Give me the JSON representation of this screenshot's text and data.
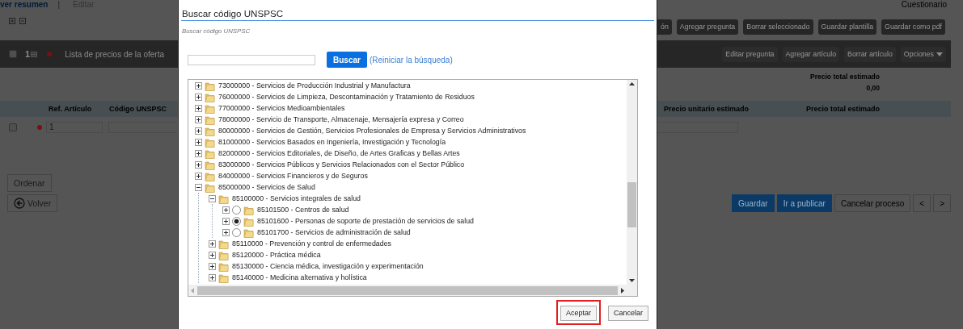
{
  "page_left": {
    "view_link": "ver resumen",
    "separator": "|",
    "edit_link": "Editar",
    "section_checked": false,
    "section_number": "1",
    "section_title": "Lista de precios de la oferta",
    "columns": [
      "Ref. Artículo",
      "Código UNSPSC"
    ],
    "row": {
      "checked": false,
      "ref": "1"
    },
    "sort_button": "Ordenar",
    "back_button": "Volver"
  },
  "page_right": {
    "title": "Cuestionario",
    "toolbar": [
      "ón",
      "Agregar pregunta",
      "Borrar seleccionado",
      "Guardar plantilla",
      "Guardar como pdf"
    ],
    "section_buttons": [
      "Editar pregunta",
      "Agregar artículo",
      "Borrar artículo",
      "Opciones"
    ],
    "total_label": "Precio total estimado",
    "total_value": "0,00",
    "columns": [
      "Precio unitario estimado",
      "Precio total estimado"
    ],
    "actions": [
      {
        "label": "Guardar",
        "kind": "primary"
      },
      {
        "label": "Ir a publicar",
        "kind": "primary"
      },
      {
        "label": "Cancelar proceso",
        "kind": "default"
      },
      {
        "label": "<",
        "kind": "default"
      },
      {
        "label": ">",
        "kind": "default"
      }
    ]
  },
  "dialog": {
    "title": "Buscar código UNSPSC",
    "subtitle": "Buscar código UNSPSC",
    "search_button": "Buscar",
    "reset_link": "(Reiniciar la búsqueda)",
    "tree": [
      {
        "kind": "group",
        "label": "73000000 - Servicios de Producción Industrial y Manufactura",
        "expanded": false
      },
      {
        "kind": "group",
        "label": "76000000 - Servicios de Limpieza, Descontaminación y Tratamiento de Residuos",
        "expanded": false
      },
      {
        "kind": "group",
        "label": "77000000 - Servicios Medioambientales",
        "expanded": false
      },
      {
        "kind": "group",
        "label": "78000000 - Servicio de Transporte, Almacenaje, Mensajería expresa y Correo",
        "expanded": false
      },
      {
        "kind": "group",
        "label": "80000000 - Servicios de Gestión, Servicios Profesionales de Empresa y Servicios Administrativos",
        "expanded": false
      },
      {
        "kind": "group",
        "label": "81000000 - Servicios Basados en Ingeniería, Investigación y Tecnología",
        "expanded": false
      },
      {
        "kind": "group",
        "label": "82000000 - Servicios Editoriales, de Diseño, de Artes Graficas y Bellas Artes",
        "expanded": false
      },
      {
        "kind": "group",
        "label": "83000000 - Servicios Públicos y Servicios Relacionados con el Sector Público",
        "expanded": false
      },
      {
        "kind": "group",
        "label": "84000000 - Servicios Financieros y de Seguros",
        "expanded": false
      },
      {
        "kind": "group",
        "label": "85000000 - Servicios de Salud",
        "expanded": true,
        "children": [
          {
            "kind": "group",
            "label": "85100000 - Servicios integrales de salud",
            "expanded": true,
            "children": [
              {
                "kind": "option",
                "label": "85101500 - Centros de salud",
                "expanded": false,
                "selected": false
              },
              {
                "kind": "option",
                "label": "85101600 - Personas de soporte de prestación de servicios de salud",
                "expanded": false,
                "selected": true
              },
              {
                "kind": "option",
                "label": "85101700 - Servicios de administración de salud",
                "expanded": false,
                "selected": false
              }
            ]
          },
          {
            "kind": "group",
            "label": "85110000 - Prevención y control de enfermedades",
            "expanded": false
          },
          {
            "kind": "group",
            "label": "85120000 - Práctica médica",
            "expanded": false
          },
          {
            "kind": "group",
            "label": "85130000 - Ciencia médica, investigación y experimentación",
            "expanded": false
          },
          {
            "kind": "group",
            "label": "85140000 - Medicina alternativa y holística",
            "expanded": false
          }
        ]
      }
    ],
    "buttons": [
      {
        "label": "Aceptar",
        "highlighted": true
      },
      {
        "label": "Cancelar",
        "highlighted": false
      }
    ]
  }
}
